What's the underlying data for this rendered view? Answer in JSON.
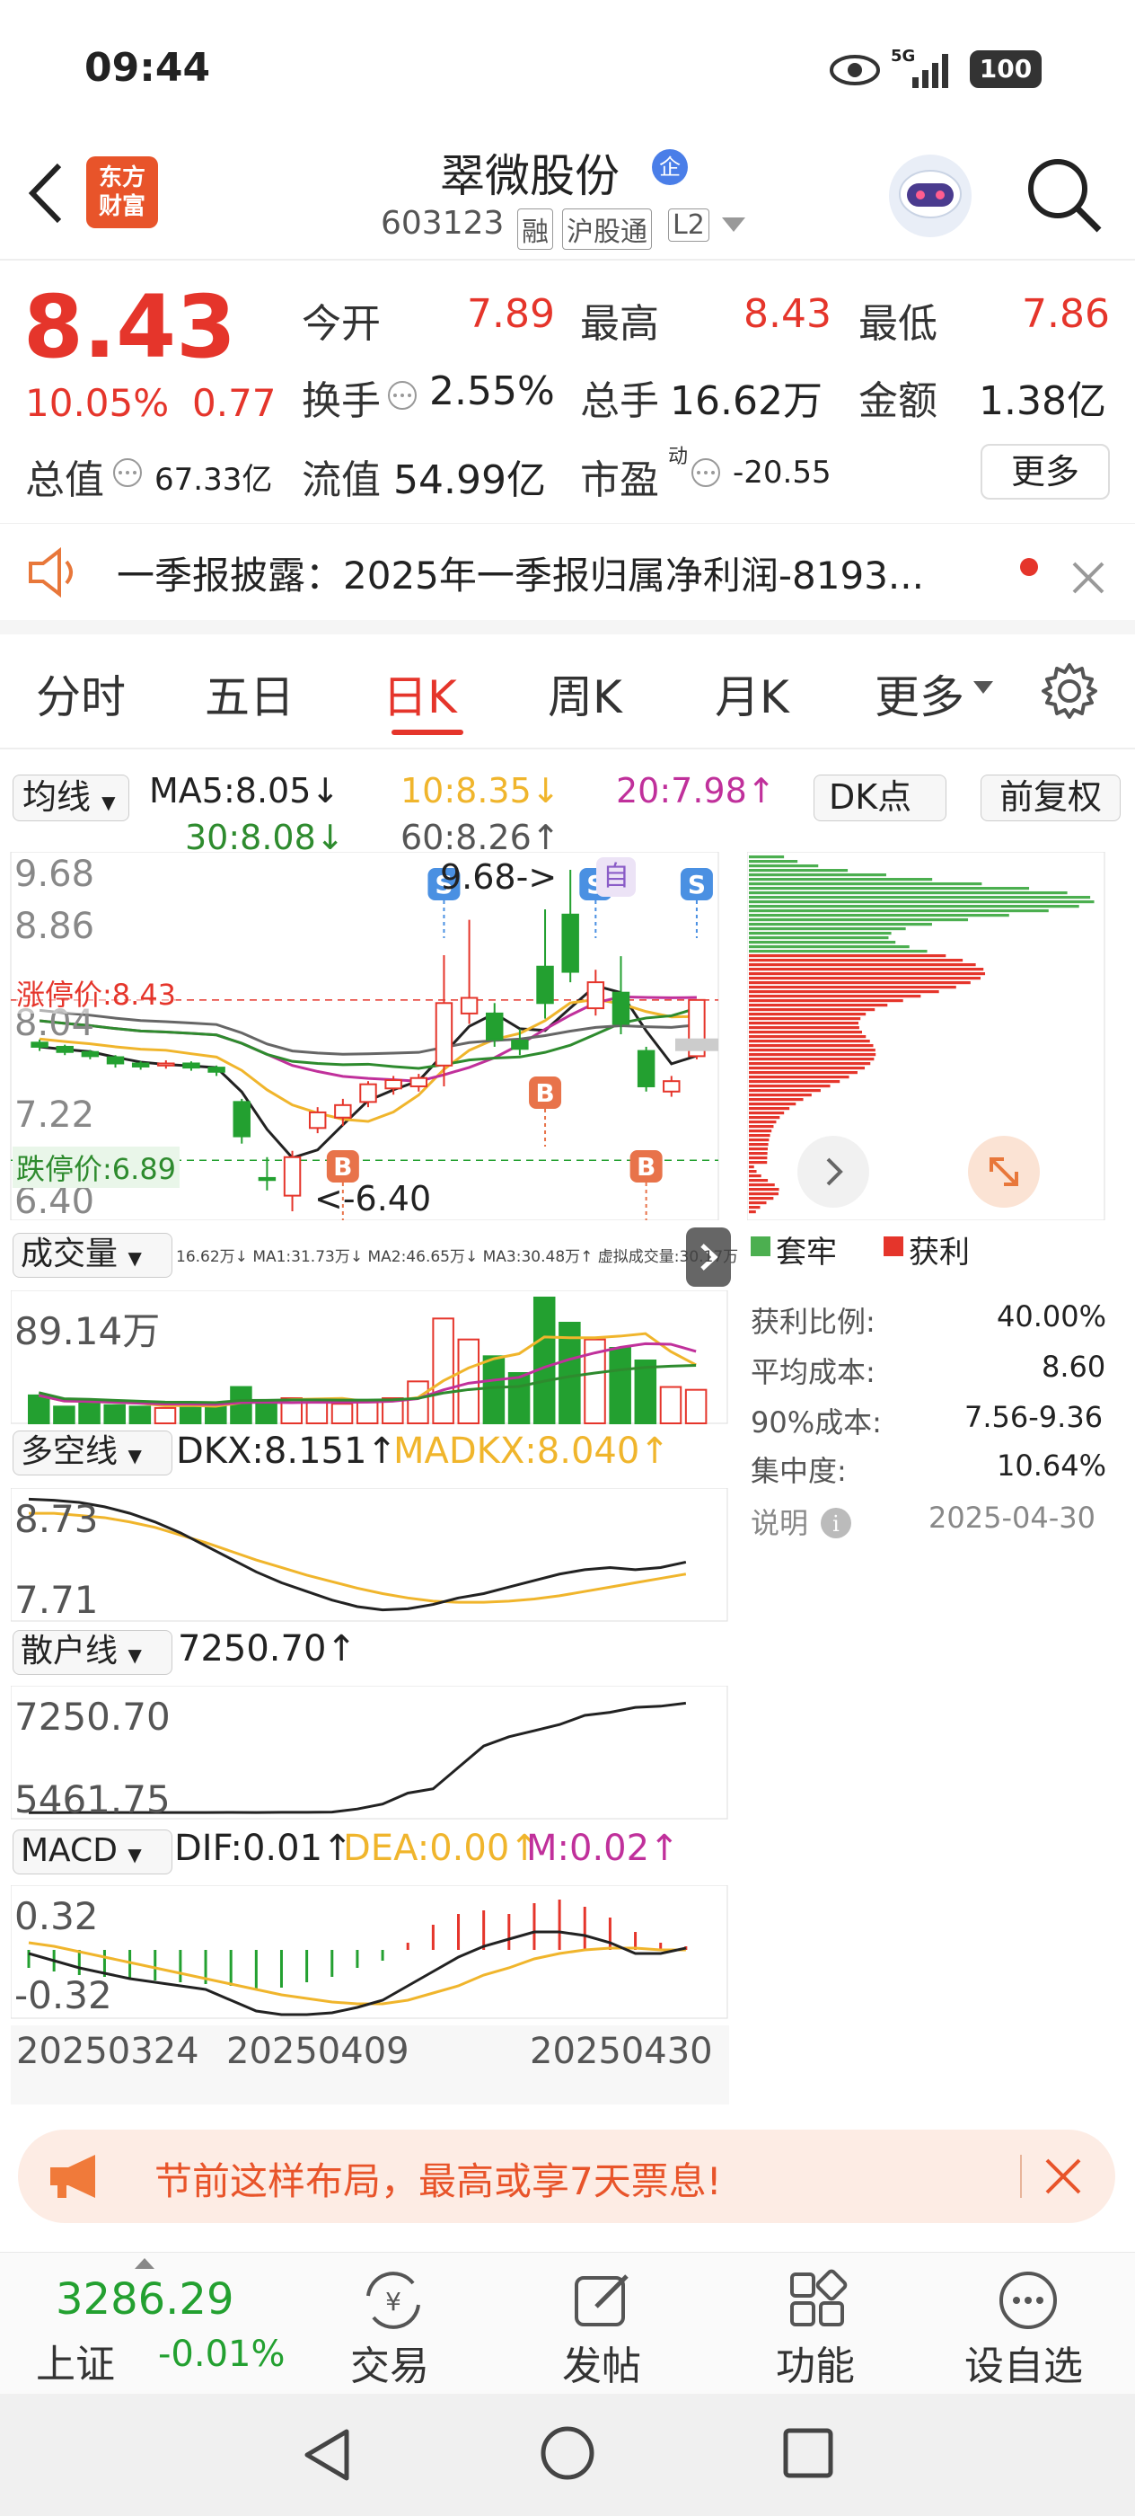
{
  "status_bar": {
    "time": "09:44",
    "network": "5G",
    "battery": "100"
  },
  "header": {
    "app_badge": "东方\n财富",
    "title": "翠微股份",
    "title_badge": "企",
    "code": "603123",
    "tags": [
      "融",
      "沪股通",
      "L2"
    ]
  },
  "quote": {
    "price": "8.43",
    "change_pct": "10.05%",
    "change_amt": "0.77",
    "stats": [
      {
        "label": "今开",
        "value": "7.89"
      },
      {
        "label": "最高",
        "value": "8.43"
      },
      {
        "label": "最低",
        "value": "7.86"
      },
      {
        "label": "换手",
        "value": "2.55%"
      },
      {
        "label": "总手",
        "value": "16.62万"
      },
      {
        "label": "金额",
        "value": "1.38亿"
      },
      {
        "label": "总值",
        "value": "67.33亿"
      },
      {
        "label": "流值",
        "value": "54.99亿"
      },
      {
        "label": "市盈",
        "sup": "动",
        "value": "-20.55"
      }
    ],
    "more_button": "更多"
  },
  "notice": {
    "text": "一季报披露：2025年一季报归属净利润-8193..."
  },
  "tabs": [
    "分时",
    "五日",
    "日K",
    "周K",
    "月K",
    "更多"
  ],
  "active_tab": 2,
  "ma_bar": {
    "selector": "均线",
    "ma5": "MA5:8.05↓",
    "ma10": "10:8.35↓",
    "ma20": "20:7.98↑",
    "ma30": "30:8.08↓",
    "ma60": "60:8.26↑",
    "dk_button": "DK点",
    "adjust_button": "前复权"
  },
  "kline": {
    "y_labels": [
      "9.68",
      "8.86",
      "8.04",
      "7.22",
      "6.40"
    ],
    "limit_up": "涨停价:8.43",
    "limit_down": "跌停价:6.89",
    "high_note": "9.68->",
    "low_note": "<-6.40",
    "self_badge": "自",
    "candles": [
      {
        "o": 8.02,
        "c": 7.98,
        "h": 8.05,
        "l": 7.94
      },
      {
        "o": 7.98,
        "c": 7.93,
        "h": 8.0,
        "l": 7.9
      },
      {
        "o": 7.93,
        "c": 7.89,
        "h": 7.95,
        "l": 7.86
      },
      {
        "o": 7.88,
        "c": 7.82,
        "h": 7.9,
        "l": 7.78
      },
      {
        "o": 7.82,
        "c": 7.79,
        "h": 7.84,
        "l": 7.76
      },
      {
        "o": 7.8,
        "c": 7.82,
        "h": 7.85,
        "l": 7.77
      },
      {
        "o": 7.82,
        "c": 7.78,
        "h": 7.84,
        "l": 7.75
      },
      {
        "o": 7.78,
        "c": 7.74,
        "h": 7.8,
        "l": 7.7
      },
      {
        "o": 7.45,
        "c": 7.12,
        "h": 7.48,
        "l": 7.05
      },
      {
        "o": 6.72,
        "c": 6.7,
        "h": 6.92,
        "l": 6.6
      },
      {
        "o": 6.55,
        "c": 6.92,
        "h": 6.98,
        "l": 6.4
      },
      {
        "o": 7.2,
        "c": 7.35,
        "h": 7.4,
        "l": 7.15
      },
      {
        "o": 7.3,
        "c": 7.42,
        "h": 7.48,
        "l": 7.22
      },
      {
        "o": 7.45,
        "c": 7.62,
        "h": 7.65,
        "l": 7.4
      },
      {
        "o": 7.58,
        "c": 7.66,
        "h": 7.7,
        "l": 7.52
      },
      {
        "o": 7.6,
        "c": 7.68,
        "h": 7.72,
        "l": 7.55
      },
      {
        "o": 7.8,
        "c": 8.4,
        "h": 8.86,
        "l": 7.6
      },
      {
        "o": 8.3,
        "c": 8.45,
        "h": 9.2,
        "l": 8.2
      },
      {
        "o": 8.3,
        "c": 8.05,
        "h": 8.4,
        "l": 7.98
      },
      {
        "o": 8.04,
        "c": 7.96,
        "h": 8.15,
        "l": 7.9
      },
      {
        "o": 8.75,
        "c": 8.4,
        "h": 9.3,
        "l": 8.25
      },
      {
        "o": 9.25,
        "c": 8.7,
        "h": 9.68,
        "l": 8.6
      },
      {
        "o": 8.35,
        "c": 8.6,
        "h": 8.72,
        "l": 8.28
      },
      {
        "o": 8.5,
        "c": 8.2,
        "h": 8.85,
        "l": 8.1
      },
      {
        "o": 7.94,
        "c": 7.6,
        "h": 7.98,
        "l": 7.55
      },
      {
        "o": 7.55,
        "c": 7.65,
        "h": 7.7,
        "l": 7.5
      },
      {
        "o": 7.89,
        "c": 8.43,
        "h": 8.43,
        "l": 7.86
      }
    ]
  },
  "chips": {
    "legend_trapped": "套牢",
    "legend_profit": "获利",
    "rows": [
      {
        "label": "获利比例:",
        "value": "40.00%"
      },
      {
        "label": "平均成本:",
        "value": "8.60"
      },
      {
        "label": "90%成本:",
        "value": "7.56-9.36"
      },
      {
        "label": "集中度:",
        "value": "10.64%"
      }
    ],
    "note_label": "说明",
    "date": "2025-04-30"
  },
  "volume": {
    "selector": "成交量",
    "info": "16.62万↓ MA1:31.73万↓ MA2:46.65万↓ MA3:30.48万↑ 虚拟成交量:30.17万",
    "y_label": "89.14万",
    "bars": [
      2.0,
      1.2,
      1.5,
      1.3,
      1.2,
      1.1,
      1.3,
      1.2,
      2.6,
      1.6,
      1.8,
      1.5,
      1.4,
      1.5,
      1.8,
      3.0,
      7.5,
      6.0,
      4.8,
      3.6,
      9.0,
      7.2,
      6.0,
      5.4,
      4.5,
      2.6,
      2.4
    ]
  },
  "dkx": {
    "selector": "多空线",
    "dkx": "DKX:8.151↑",
    "madkx": "MADKX:8.040↑",
    "y_labels": [
      "8.73",
      "7.71"
    ]
  },
  "retail": {
    "selector": "散户线",
    "value": "7250.70↑",
    "y_labels": [
      "7250.70",
      "5461.75"
    ]
  },
  "macd": {
    "selector": "MACD",
    "dif": "DIF:0.01↑",
    "dea": "DEA:0.00↑",
    "m": "M:0.02↑",
    "y_labels": [
      "0.32",
      "-0.32"
    ],
    "bars": [
      -0.1,
      -0.12,
      -0.14,
      -0.15,
      -0.16,
      -0.17,
      -0.18,
      -0.19,
      -0.2,
      -0.22,
      -0.21,
      -0.18,
      -0.15,
      -0.1,
      -0.06,
      0.04,
      0.14,
      0.2,
      0.22,
      0.2,
      0.26,
      0.28,
      0.24,
      0.18,
      0.1,
      0.04,
      0.02
    ]
  },
  "dates": [
    "20250324",
    "20250409",
    "20250430"
  ],
  "promo": {
    "text": "节前这样布局，最高或享7天票息!"
  },
  "bottom_nav": {
    "index_value": "3286.29",
    "index_name": "上证",
    "index_change": "-0.01%",
    "items": [
      "交易",
      "发帖",
      "功能",
      "设自选"
    ]
  },
  "colors": {
    "red": "#e5352b",
    "green": "#23a030",
    "ma5": "#222222",
    "ma10": "#f0b52c",
    "ma20": "#c0309b",
    "ma30": "#2e8b2e",
    "ma60": "#666666"
  }
}
